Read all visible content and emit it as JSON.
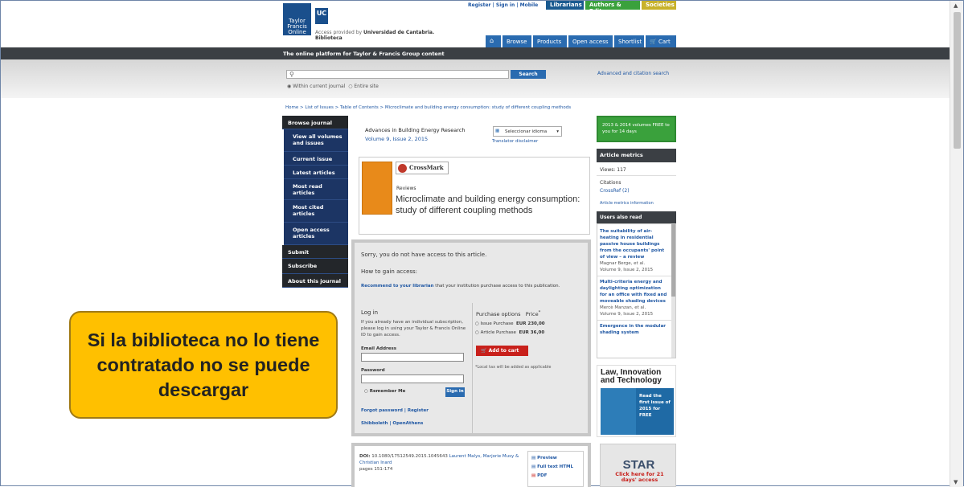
{
  "header": {
    "logo_lines": [
      "Taylor",
      "Francis",
      "Online"
    ],
    "uc_badge": "UC",
    "access_text": "Access provided by",
    "institution": "Universidad de Cantabria.",
    "institution_line2": "Biblioteca",
    "top_links": [
      "Register",
      "Sign in",
      "Mobile"
    ],
    "top_tabs": [
      "Librarians",
      "Authors & Editors",
      "Societies"
    ],
    "nav": [
      "Browse",
      "Products",
      "Open access",
      "Shortlist",
      "Cart"
    ],
    "tagline": "The online platform for Taylor & Francis Group content"
  },
  "search": {
    "button": "Search",
    "advanced": "Advanced and citation search",
    "option_journal": "Within current journal",
    "option_site": "Entire site"
  },
  "breadcrumb": "Home > List of Issues > Table of Contents > Microclimate and building energy consumption: study of different coupling methods",
  "left_nav": [
    "Browse journal",
    "View all volumes and issues",
    "Current issue",
    "Latest articles",
    "Most read articles",
    "Most cited articles",
    "Open access articles",
    "Submit",
    "Subscribe",
    "About this journal"
  ],
  "journal": {
    "title": "Advances in Building Energy Research",
    "issue": "Volume 9, Issue 2, 2015",
    "translate": "Seleccionar idioma",
    "translator": "Translator disclaimer",
    "crossmark": "CrossMark",
    "section": "Reviews",
    "article_title": "Microclimate and building energy consumption: study of different coupling methods"
  },
  "access": {
    "sorry": "Sorry, you do not have access to this article.",
    "how": "How to gain access:",
    "recommend_link": "Recommend to your librarian",
    "recommend_rest": " that your institution purchase access to this publication.",
    "login_title": "Log in",
    "login_help": "If you already have an individual subscription, please log in using your Taylor & Francis Online ID to gain access.",
    "email_label": "Email Address",
    "password_label": "Password",
    "remember": "Remember Me",
    "signin": "Sign in",
    "forgot": "Forgot password",
    "register": "Register",
    "shibboleth": "Shibboleth",
    "openathens": "OpenAthens",
    "purchase_title": "Purchase options",
    "price_title": "Price",
    "issue_purchase": "Issue Purchase",
    "issue_price": "EUR 230,00",
    "article_purchase": "Article Purchase",
    "article_price": "EUR 36,00",
    "add_cart": "Add to cart",
    "tax_note": "*Local tax will be added as applicable"
  },
  "doi": {
    "label": "DOI:",
    "value": "10.1080/17512549.2015.1045643",
    "authors": "Laurent Malys, Marjorie Musy & Christian Inard",
    "pages": "pages 151-174",
    "preview": "Preview",
    "fulltext": "Full text HTML",
    "pdf": "PDF"
  },
  "right": {
    "promo": "2013 & 2014 volumes FREE to you for 14 days",
    "metrics_title": "Article metrics",
    "views": "Views: 117",
    "citations": "Citations",
    "crossref": "CrossRef (2)",
    "metrics_info": "Article metrics information",
    "users_read": "Users also read",
    "read_items": [
      {
        "title": "The suitability of air-heating in residential passive house buildings from the occupants' point of view – a review",
        "author": "Magnar Berge, et al.",
        "vol": "Volume 9, Issue 2, 2015"
      },
      {
        "title": "Multi-criteria energy and daylighting optimization for an office with fixed and moveable shading devices",
        "author": "Mercè Manzan, et al.",
        "vol": "Volume 9, Issue 2, 2015"
      },
      {
        "title": "Emergence in the modular shading system",
        "author": "",
        "vol": ""
      }
    ],
    "ad1_title": "Law, Innovation and Technology",
    "ad1_text": "Read the first issue of 2015 for FREE",
    "ad2_title": "STAR",
    "ad2_text": "Click here for 21 days' access"
  },
  "callout": "Si la biblioteca no lo tiene contratado no se puede descargar",
  "colors": {
    "accent": "#2a6bb0",
    "callout": "#ffc000",
    "green": "#3aa13c"
  }
}
